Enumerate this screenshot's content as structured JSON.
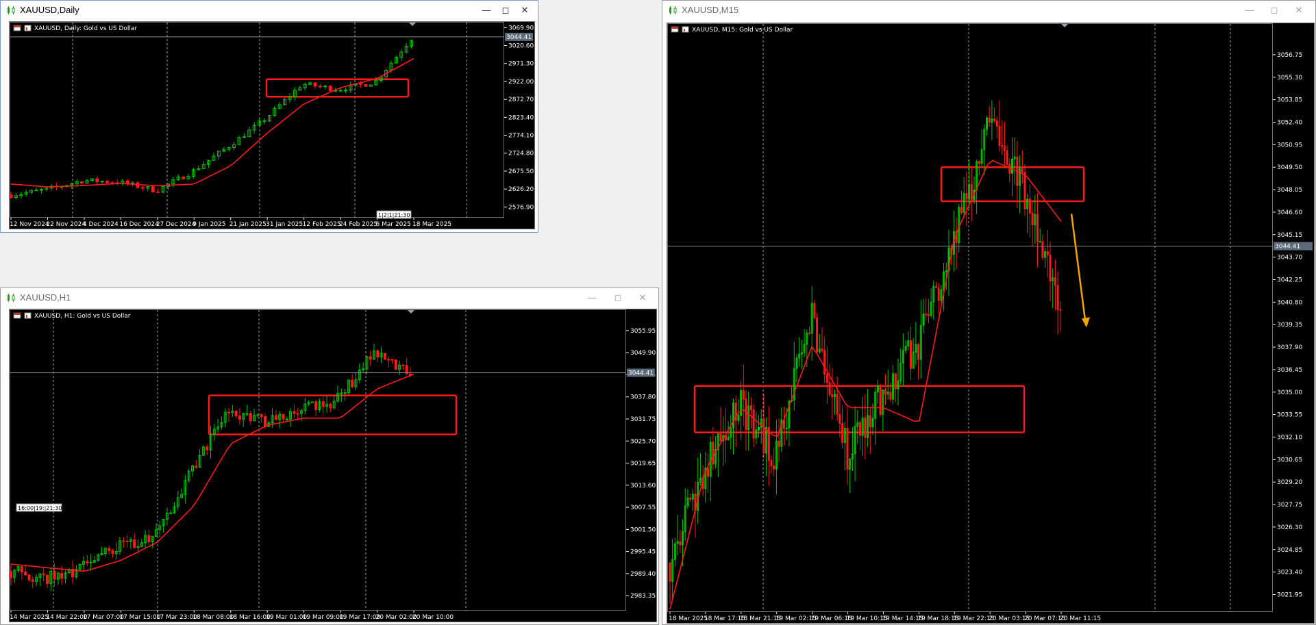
{
  "colors": {
    "bull": "#00c400",
    "bear": "#ff1a1a",
    "ma": "#ff1a1a",
    "zone": "#ff1a1a",
    "grid": "#c8c8c8",
    "axis": "#ffffff",
    "arrow": "#f2a400",
    "priceLine": "#7d8b96"
  },
  "icons": {
    "window": "candlestick-icon",
    "symbol": "flag-icon",
    "chart": "chart-icon"
  },
  "windows": {
    "daily": {
      "title": "XAUUSD,Daily",
      "chart_label": "XAUUSD, Daily:  Gold vs US Dollar",
      "price_badge": "3044.41",
      "time_badge": "1|2|1|21:30",
      "yticks": [
        "3069.90",
        "3020.60",
        "2971.30",
        "2922.00",
        "2872.70",
        "2823.40",
        "2774.10",
        "2724.80",
        "2675.50",
        "2626.20",
        "2576.90"
      ],
      "xticks": [
        "12 Nov 2024",
        "22 Nov 2024",
        "4 Dec 2024",
        "16 Dec 2024",
        "27 Dec 2024",
        "9 Jan 2025",
        "21 Jan 2025",
        "31 Jan 2025",
        "12 Feb 2025",
        "24 Feb 2025",
        "6 Mar 2025",
        "18 Mar 2025"
      ]
    },
    "h1": {
      "title": "XAUUSD,H1",
      "chart_label": "XAUUSD, H1:  Gold vs US Dollar",
      "price_badge": "3044.41",
      "time_badge": "16:00|19:|21:30",
      "yticks": [
        "3055.95",
        "3049.90",
        "3043.85",
        "3037.80",
        "3031.75",
        "3025.70",
        "3019.65",
        "3013.60",
        "3007.55",
        "3001.50",
        "2995.45",
        "2989.40",
        "2983.35"
      ],
      "xticks": [
        "14 Mar 2025",
        "14 Mar 22:00",
        "17 Mar 07:00",
        "17 Mar 15:00",
        "17 Mar 23:00",
        "18 Mar 08:00",
        "18 Mar 16:00",
        "19 Mar 01:00",
        "19 Mar 09:00",
        "19 Mar 17:00",
        "20 Mar 02:00",
        "20 Mar 10:00"
      ]
    },
    "m15": {
      "title": "XAUUSD,M15",
      "chart_label": "XAUUSD, M15:  Gold vs US Dollar",
      "price_badge": "3044.41",
      "yticks": [
        "3056.75",
        "3055.30",
        "3053.85",
        "3052.40",
        "3050.95",
        "3049.50",
        "3048.05",
        "3046.60",
        "3045.15",
        "3043.70",
        "3042.25",
        "3040.80",
        "3039.35",
        "3037.90",
        "3036.45",
        "3035.00",
        "3033.55",
        "3032.10",
        "3030.65",
        "3029.20",
        "3027.75",
        "3026.30",
        "3024.85",
        "3023.40",
        "3021.95"
      ],
      "xticks": [
        "18 Mar 2025",
        "18 Mar 17:15",
        "18 Mar 21:15",
        "19 Mar 02:15",
        "19 Mar 06:15",
        "19 Mar 10:15",
        "19 Mar 14:15",
        "19 Mar 18:15",
        "19 Mar 22:15",
        "20 Mar 03:15",
        "20 Mar 07:15",
        "20 Mar 11:15"
      ]
    }
  },
  "chart_data": [
    {
      "type": "candlestick",
      "title": "XAUUSD, Daily:  Gold vs US Dollar",
      "ylim": [
        2555,
        3078
      ],
      "current_price": 3044.41,
      "categories": [
        "12 Nov 2024",
        "22 Nov 2024",
        "4 Dec 2024",
        "16 Dec 2024",
        "27 Dec 2024",
        "9 Jan 2025",
        "21 Jan 2025",
        "31 Jan 2025",
        "12 Feb 2025",
        "24 Feb 2025",
        "6 Mar 2025",
        "18 Mar 2025"
      ],
      "close_at_labels": [
        2610,
        2625,
        2650,
        2645,
        2622,
        2675,
        2745,
        2820,
        2915,
        2900,
        2920,
        3040
      ],
      "ma_at_labels": [
        2640,
        2632,
        2636,
        2642,
        2635,
        2640,
        2690,
        2780,
        2860,
        2905,
        2930,
        2985
      ],
      "zone": {
        "price_low": 2880,
        "price_high": 2928,
        "from": "31 Jan 2025",
        "to": "18 Mar 2025"
      }
    },
    {
      "type": "candlestick",
      "title": "XAUUSD, H1:  Gold vs US Dollar",
      "ylim": [
        2980,
        3061
      ],
      "current_price": 3044.41,
      "categories": [
        "14 Mar 2025",
        "14 Mar 22:00",
        "17 Mar 07:00",
        "17 Mar 15:00",
        "17 Mar 23:00",
        "18 Mar 08:00",
        "18 Mar 16:00",
        "19 Mar 01:00",
        "19 Mar 09:00",
        "19 Mar 17:00",
        "20 Mar 02:00",
        "20 Mar 10:00"
      ],
      "close_at_labels": [
        2990,
        2988,
        2991,
        2997,
        3000,
        3018,
        3034,
        3031,
        3034,
        3037,
        3050,
        3044
      ],
      "ma_at_labels": [
        2992,
        2991,
        2990,
        2993,
        2998,
        3008,
        3025,
        3030,
        3032,
        3032,
        3040,
        3044
      ],
      "zone": {
        "price_low": 3028,
        "price_high": 3038,
        "from": "18 Mar 08:00",
        "to": "20 Mar 10:00"
      }
    },
    {
      "type": "candlestick",
      "title": "XAUUSD, M15:  Gold vs US Dollar",
      "ylim": [
        3021,
        3058.6
      ],
      "current_price": 3044.41,
      "categories": [
        "18 Mar 2025",
        "18 Mar 17:15",
        "18 Mar 21:15",
        "19 Mar 02:15",
        "19 Mar 06:15",
        "19 Mar 10:15",
        "19 Mar 14:15",
        "19 Mar 18:15",
        "19 Mar 22:15",
        "20 Mar 03:15",
        "20 Mar 07:15",
        "20 Mar 11:15"
      ],
      "close_at_labels": [
        3024,
        3030,
        3034,
        3031,
        3040,
        3031,
        3035,
        3038,
        3045,
        3052,
        3048,
        3041
      ],
      "ma_at_labels": [
        3021,
        3030,
        3034,
        3032,
        3038,
        3034,
        3034,
        3033,
        3045,
        3050,
        3049,
        3046
      ],
      "zones": [
        {
          "price_low": 3032.4,
          "price_high": 3035.4
        },
        {
          "price_low": 3047.3,
          "price_high": 3049.5
        }
      ],
      "projection": "down"
    }
  ]
}
